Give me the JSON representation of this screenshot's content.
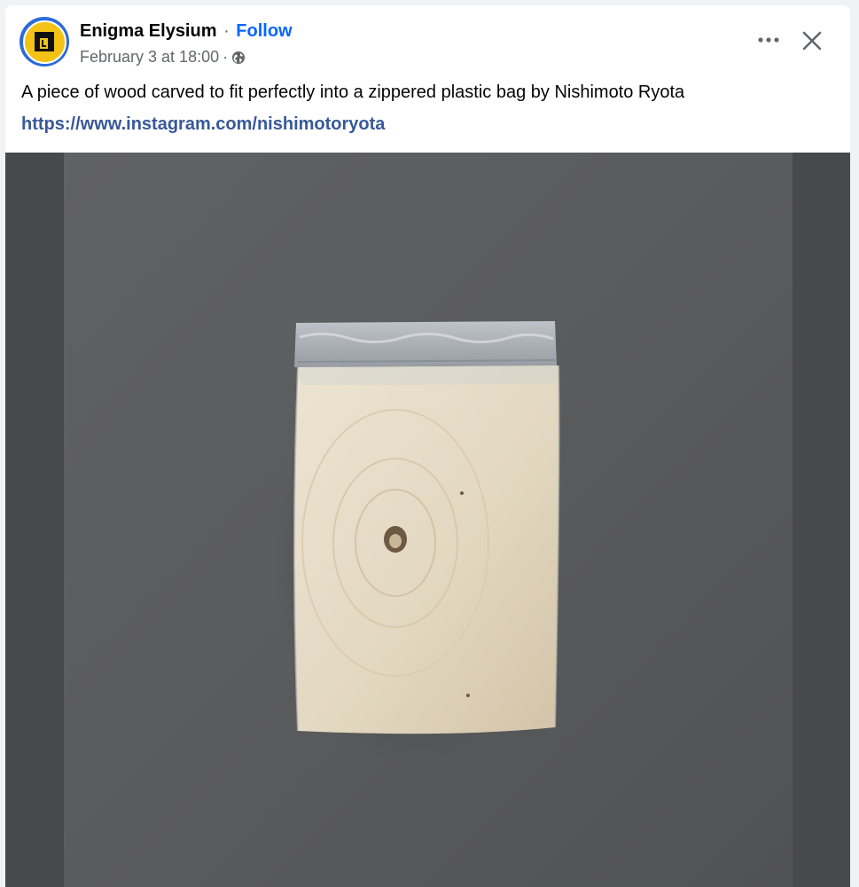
{
  "post": {
    "author": "Enigma Elysium",
    "separator": "·",
    "follow_label": "Follow",
    "timestamp": "February 3 at 18:00",
    "meta_separator": "·",
    "audience_icon": "globe-icon",
    "more_icon": "more-horizontal-icon",
    "close_icon": "close-icon",
    "text": "A piece of wood carved to fit perfectly into a zippered plastic bag by Nishimoto Ryota",
    "link": "https://www.instagram.com/nishimotoryota",
    "image_subject": "wooden block inside zippered plastic bag on grey wall"
  },
  "colors": {
    "follow": "#0866ff",
    "link": "#385898",
    "avatar_ring": "#2d6ad8",
    "avatar_fill": "#f2c316",
    "wall": "#5a5b5c",
    "wood": "#e6dcc6"
  }
}
